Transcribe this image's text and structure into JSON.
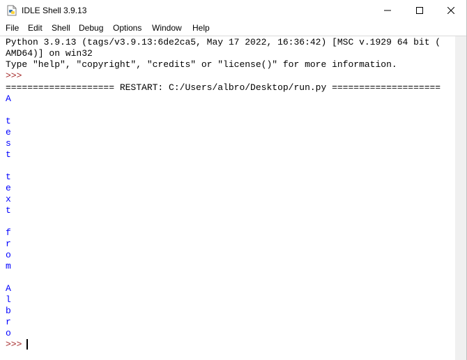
{
  "window": {
    "title": "IDLE Shell 3.9.13",
    "icon": "python-idle-icon",
    "controls": [
      "minimize-icon",
      "maximize-icon",
      "close-icon"
    ]
  },
  "menu": [
    "File",
    "Edit",
    "Shell",
    "Debug",
    "Options",
    "Window",
    "Help"
  ],
  "shell": {
    "banner_line1": "Python 3.9.13 (tags/v3.9.13:6de2ca5, May 17 2022, 16:36:42) [MSC v.1929 64 bit (",
    "banner_line2": "AMD64)] on win32",
    "banner_line3": "Type \"help\", \"copyright\", \"credits\" or \"license()\" for more information.",
    "prompt": ">>>",
    "restart_line": "==================== RESTART: C:/Users/albro/Desktop/run.py ====================",
    "output_lines": [
      "A",
      "",
      "t",
      "e",
      "s",
      "t",
      "",
      "t",
      "e",
      "x",
      "t",
      "",
      "f",
      "r",
      "o",
      "m",
      "",
      "A",
      "l",
      "b",
      "r",
      "o"
    ],
    "final_prompt": ">>> "
  },
  "colors": {
    "prompt": "#a52a2a",
    "stdout": "#0000ff",
    "text": "#000000"
  }
}
